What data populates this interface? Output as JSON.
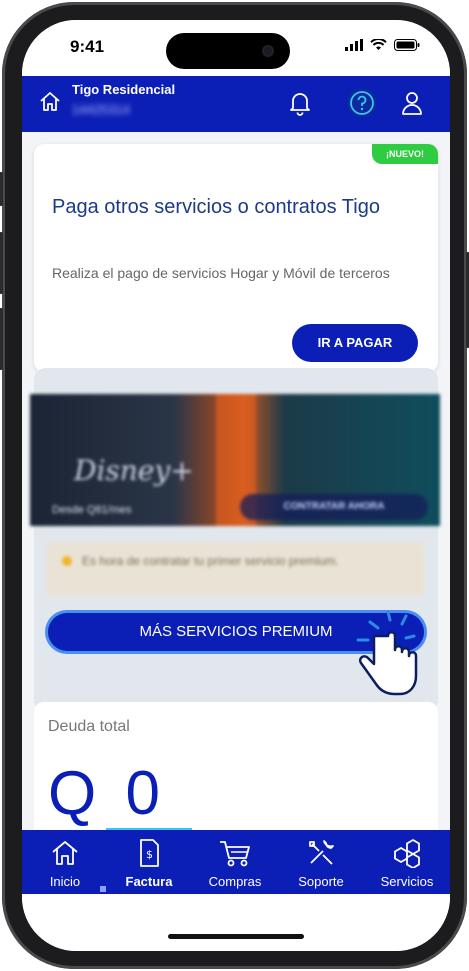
{
  "status": {
    "time": "9:41"
  },
  "header": {
    "brand": "Tigo Residencial",
    "account": "14425314"
  },
  "promo_card": {
    "badge": "¡NUEVO!",
    "title": "Paga otros servicios o contratos Tigo",
    "description": "Realiza el pago de servicios Hogar y Móvil de terceros",
    "button": "IR A PAGAR"
  },
  "premium": {
    "banner_logo": "Disney+",
    "banner_from": "Desde Q81/mes",
    "banner_cta": "CONTRATAR AHORA",
    "info": "Es hora de contratar tu primer servicio premium.",
    "button": "MÁS SERVICIOS PREMIUM"
  },
  "debt": {
    "label": "Deuda total",
    "value": "Q 0"
  },
  "tabs": [
    {
      "label": "Inicio",
      "icon": "home-icon"
    },
    {
      "label": "Factura",
      "icon": "invoice-icon"
    },
    {
      "label": "Compras",
      "icon": "cart-icon"
    },
    {
      "label": "Soporte",
      "icon": "tools-icon"
    },
    {
      "label": "Servicios",
      "icon": "services-icon"
    }
  ],
  "active_tab": "Factura",
  "colors": {
    "brand_blue": "#0b1fb6",
    "badge_green": "#2ecc40",
    "accent_cyan": "#3ec3f2"
  }
}
